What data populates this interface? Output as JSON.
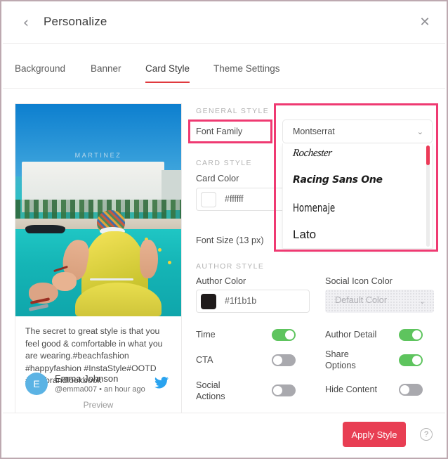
{
  "window": {
    "title": "Personalize",
    "back_icon": "chevron-left-icon",
    "close_icon": "close-icon"
  },
  "tabs": [
    {
      "label": "Background",
      "active": false
    },
    {
      "label": "Banner",
      "active": false
    },
    {
      "label": "Card Style",
      "active": true
    },
    {
      "label": "Theme Settings",
      "active": false
    }
  ],
  "preview": {
    "photo_caption_word": "MARTINEZ",
    "body_text": "The secret to great style is that you feel good & comfortable in what you are wearing.#beachfashion #happyfashion #InstaStyle#OOTD #Thebrandlookbook",
    "author": {
      "avatar_initial": "E",
      "name": "Emma Johnson",
      "meta": "@emma007 • an hour ago",
      "network_icon": "twitter-icon"
    },
    "label": "Preview"
  },
  "settings": {
    "general_style_heading": "GENERAL STYLE",
    "font_family_label": "Font Family",
    "font_family_selected": "Montserrat",
    "font_family_options": [
      "Rochester",
      "Racing Sans One",
      "Homenaje",
      "Lato"
    ],
    "card_style_heading": "CARD STYLE",
    "card_color_label": "Card Color",
    "card_color_value": "#ffffff",
    "font_size_label": "Font Size (13 px)",
    "author_style_heading": "AUTHOR STYLE",
    "author_color_label": "Author Color",
    "author_color_value": "#1f1b1b",
    "social_icon_color_label": "Social Icon Color",
    "social_icon_color_value": "Default Color",
    "toggles": [
      {
        "label": "Time",
        "state": "on"
      },
      {
        "label": "Author Detail",
        "state": "on"
      },
      {
        "label": "CTA",
        "state": "off"
      },
      {
        "label": "Share Options",
        "state": "on"
      },
      {
        "label": "Social Actions",
        "state": "off"
      },
      {
        "label": "Hide Content",
        "state": "off"
      }
    ]
  },
  "footer": {
    "apply_label": "Apply Style",
    "help_icon": "question-mark-icon",
    "help_glyph": "?"
  },
  "icons": {
    "chevron_left": "‹",
    "close": "✕",
    "chevron_down": "⌄"
  },
  "colors": {
    "accent_red": "#e83e53",
    "tab_underline": "#e03a3e",
    "annotation_pink": "#ef3a72",
    "toggle_on_green": "#5ec45e",
    "toggle_off_gray": "#a9a9ae",
    "avatar_blue": "#5bb3e4",
    "scrollbar_thumb": "#ec3a57"
  }
}
